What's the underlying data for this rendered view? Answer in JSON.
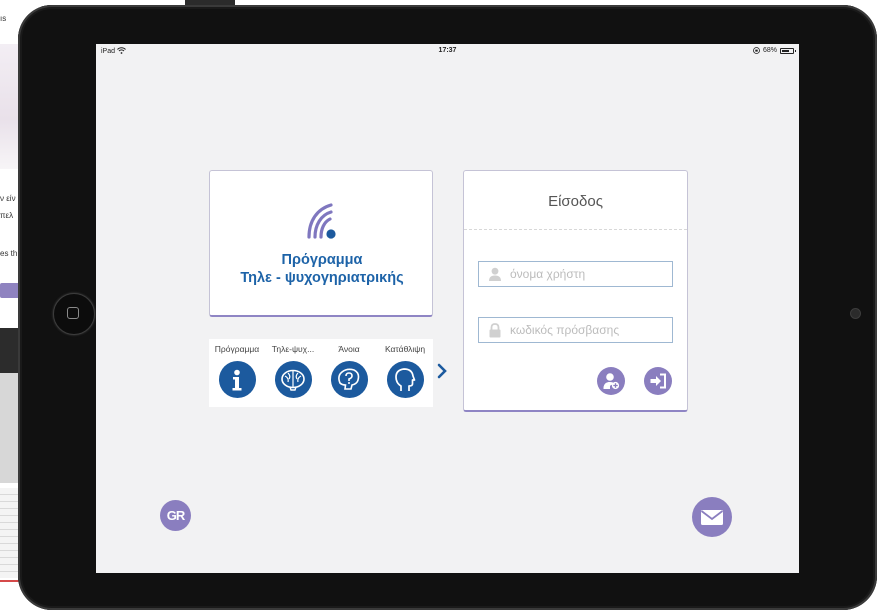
{
  "background": {
    "texts": [
      "ıs",
      "ν είν",
      "πελ",
      "es th"
    ]
  },
  "statusbar": {
    "device": "iPad",
    "time": "17:37",
    "battery": "68%"
  },
  "program_card": {
    "title_line1": "Πρόγραμμα",
    "title_line2": "Τηλε - ψυχογηριατρικής"
  },
  "icon_row": {
    "items": [
      {
        "label": "Πρόγραμμα",
        "icon": "info-icon"
      },
      {
        "label": "Τηλε-ψυχ...",
        "icon": "brain-icon"
      },
      {
        "label": "Άνοια",
        "icon": "head-question-icon"
      },
      {
        "label": "Κατάθλιψη",
        "icon": "head-profile-icon"
      }
    ]
  },
  "login": {
    "title": "Είσοδος",
    "username_placeholder": "όνομα χρήστη",
    "password_placeholder": "κωδικός πρόσβασης"
  },
  "language": {
    "label": "GR"
  },
  "colors": {
    "accent": "#8a7ebf",
    "brand_blue": "#1c5a9e"
  }
}
